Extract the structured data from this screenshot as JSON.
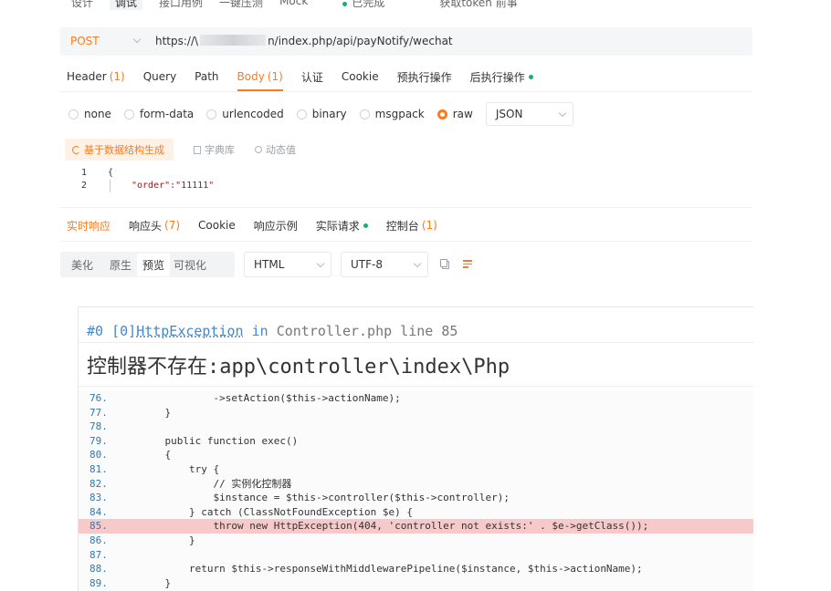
{
  "top_tabs": [
    "设计",
    "调试",
    "接口用例",
    "一键压测",
    "Mock"
  ],
  "top_status": "已完成",
  "top_token_text": "获取token 前事",
  "url_bar": {
    "method": "POST",
    "url_prefix": "https://\\",
    "url_suffix": "n/index.php/api/payNotify/wechat"
  },
  "request_tabs": [
    {
      "label": "Header",
      "count": "(1)"
    },
    {
      "label": "Query",
      "count": ""
    },
    {
      "label": "Path",
      "count": ""
    },
    {
      "label": "Body",
      "count": "(1)"
    },
    {
      "label": "认证",
      "count": ""
    },
    {
      "label": "Cookie",
      "count": ""
    },
    {
      "label": "预执行操作",
      "count": ""
    },
    {
      "label": "后执行操作",
      "count": ""
    }
  ],
  "active_request_tab": "Body",
  "body_types": [
    "none",
    "form-data",
    "urlencoded",
    "binary",
    "msgpack",
    "raw"
  ],
  "selected_body_type": "raw",
  "body_format": "JSON",
  "body_tools": {
    "generate": "基于数据结构生成",
    "dictionary": "字典库",
    "dynamic": "动态值"
  },
  "editor": {
    "lines": [
      {
        "n": "1",
        "text": "{"
      },
      {
        "n": "2",
        "text": "\"order\":\"11111\""
      }
    ]
  },
  "response_tabs": [
    {
      "label": "实时响应",
      "count": ""
    },
    {
      "label": "响应头",
      "count": "(7)"
    },
    {
      "label": "Cookie",
      "count": ""
    },
    {
      "label": "响应示例",
      "count": ""
    },
    {
      "label": "实际请求",
      "count": ""
    },
    {
      "label": "控制台",
      "count": "(1)"
    }
  ],
  "view_modes": [
    "美化",
    "原生",
    "预览",
    "可视化"
  ],
  "active_view_mode": "预览",
  "response_format": "HTML",
  "response_encoding": "UTF-8",
  "error": {
    "prefix": "#0 [0]",
    "exception": "HttpException",
    "in_text": " in ",
    "file": "Controller.php",
    "line_text": " line 85",
    "message": "控制器不存在:app\\controller\\index\\Php"
  },
  "code_lines": [
    {
      "n": "76.",
      "text": "            ->setAction($this->actionName);",
      "hl": false
    },
    {
      "n": "77.",
      "text": "    }",
      "hl": false
    },
    {
      "n": "78.",
      "text": "",
      "hl": false
    },
    {
      "n": "79.",
      "text": "    public function exec()",
      "hl": false
    },
    {
      "n": "80.",
      "text": "    {",
      "hl": false
    },
    {
      "n": "81.",
      "text": "        try {",
      "hl": false
    },
    {
      "n": "82.",
      "text": "            // 实例化控制器",
      "hl": false
    },
    {
      "n": "83.",
      "text": "            $instance = $this->controller($this->controller);",
      "hl": false
    },
    {
      "n": "84.",
      "text": "        } catch (ClassNotFoundException $e) {",
      "hl": false
    },
    {
      "n": "85.",
      "text": "            throw new HttpException(404, 'controller not exists:' . $e->getClass());",
      "hl": true
    },
    {
      "n": "86.",
      "text": "        }",
      "hl": false
    },
    {
      "n": "87.",
      "text": "",
      "hl": false
    },
    {
      "n": "88.",
      "text": "        return $this->responseWithMiddlewarePipeline($instance, $this->actionName);",
      "hl": false
    },
    {
      "n": "89.",
      "text": "    }",
      "hl": false
    }
  ]
}
